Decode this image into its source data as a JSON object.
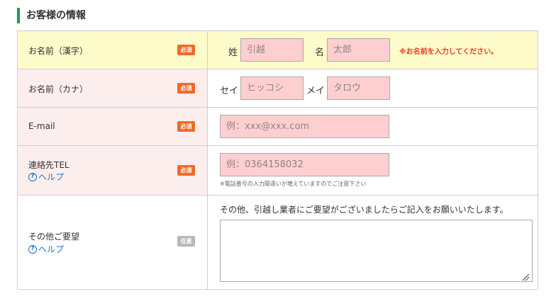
{
  "section": {
    "title": "お客様の情報"
  },
  "rows": {
    "name_kanji": {
      "label": "お名前（漢字）",
      "badge": "必須",
      "last_prefix": "姓",
      "last_placeholder": "引越",
      "first_prefix": "名",
      "first_placeholder": "太郎",
      "error": "※お名前を入力してください。"
    },
    "name_kana": {
      "label": "お名前（カナ）",
      "badge": "必須",
      "last_prefix": "セイ",
      "last_placeholder": "ヒッコシ",
      "first_prefix": "メイ",
      "first_placeholder": "タロウ"
    },
    "email": {
      "label": "E-mail",
      "badge": "必須",
      "placeholder": "例：xxx@xxx.com"
    },
    "tel": {
      "label": "連絡先TEL",
      "help": "ヘルプ",
      "badge": "必須",
      "placeholder": "例：0364158032",
      "note": "※電話番号の入力間違いが増えていますのでご注意下さい"
    },
    "other": {
      "label": "その他ご要望",
      "help": "ヘルプ",
      "badge": "任意",
      "instruction": "その他、引越し業者にご要望がございましたらご記入をお願いいたします。",
      "value": ""
    }
  },
  "colors": {
    "accent": "#15a05a",
    "required_badge": "#f06a28",
    "optional_badge": "#b8b8b8",
    "field_bg": "#ffcfd0",
    "error_text": "#ee3b2a",
    "highlight_row": "#fdfbc9",
    "label_bg": "#fdeeee",
    "help_link": "#1a73c8"
  },
  "icons": {
    "help": "question-circle-icon",
    "resize": "resize-grip-icon"
  }
}
